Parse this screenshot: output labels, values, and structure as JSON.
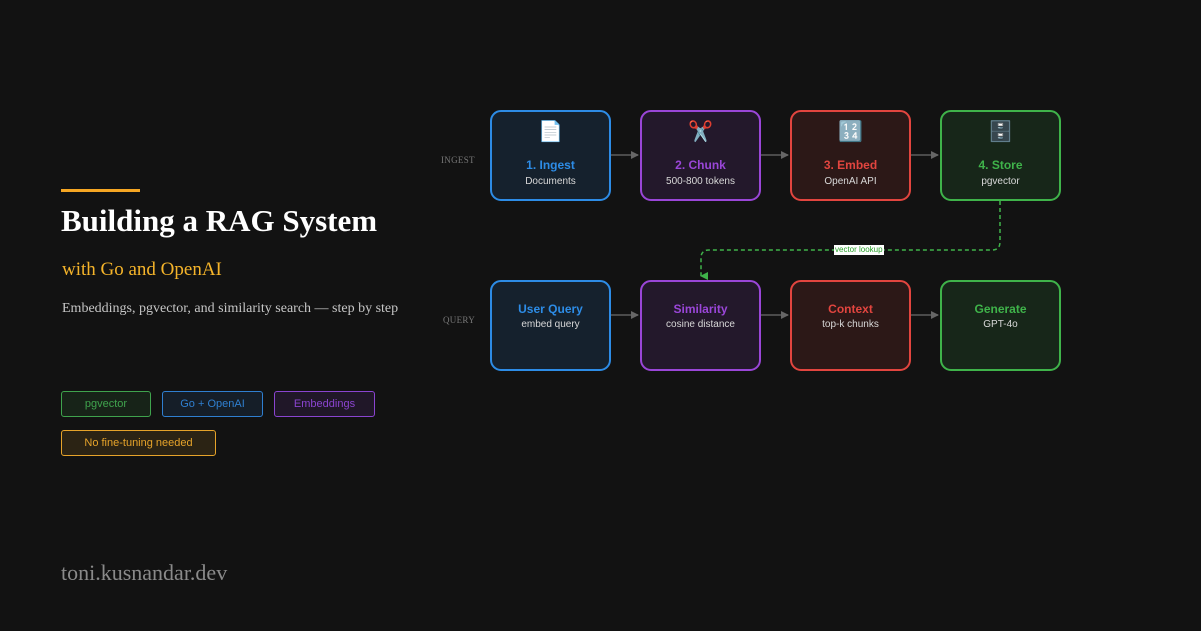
{
  "hero": {
    "title": "Building a RAG System",
    "subtitle": "with Go and OpenAI",
    "tagline": "Embeddings, pgvector, and similarity search — step by step"
  },
  "badges": [
    {
      "label": "pgvector",
      "color": "#3fa34d"
    },
    {
      "label": "Go + OpenAI",
      "color": "#2f7fd0"
    },
    {
      "label": "Embeddings",
      "color": "#8a44d0"
    },
    {
      "label": "No fine-tuning needed",
      "color": "#e6a32a"
    }
  ],
  "footer": {
    "site": "toni.kusnandar.dev"
  },
  "diagram": {
    "ingest_label": "INGEST",
    "query_label": "QUERY",
    "lookup_label": "vector lookup",
    "ingest_nodes": [
      {
        "icon": "📄",
        "icon_name": "document-icon",
        "title": "1. Ingest",
        "sub": "Documents",
        "color": "#2d8ce6"
      },
      {
        "icon": "✂️",
        "icon_name": "scissors-icon",
        "title": "2. Chunk",
        "sub": "500-800 tokens",
        "color": "#9a46d8"
      },
      {
        "icon": "🔢",
        "icon_name": "numbers-icon",
        "title": "3. Embed",
        "sub": "OpenAI API",
        "color": "#e2453f"
      },
      {
        "icon": "🗄️",
        "icon_name": "file-cabinet-icon",
        "title": "4. Store",
        "sub": "pgvector",
        "color": "#3fb34a"
      }
    ],
    "query_nodes": [
      {
        "title": "User Query",
        "sub": "embed query",
        "color": "#2d8ce6"
      },
      {
        "title": "Similarity",
        "sub": "cosine distance",
        "color": "#9a46d8"
      },
      {
        "title": "Context",
        "sub": "top-k chunks",
        "color": "#e2453f"
      },
      {
        "title": "Generate",
        "sub": "GPT-4o",
        "color": "#3fb34a"
      }
    ]
  }
}
